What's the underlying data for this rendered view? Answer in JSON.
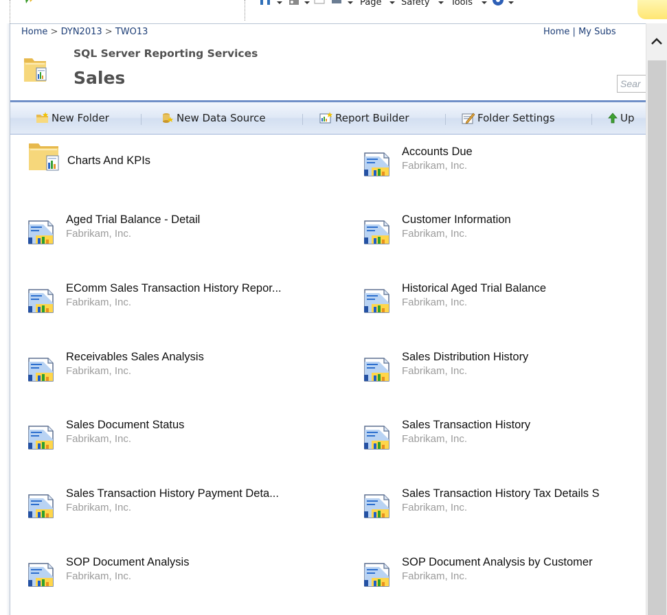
{
  "browser_commandbar": {
    "page_label": "Page",
    "safety_label": "Safety",
    "tools_label": "Tools"
  },
  "breadcrumb": {
    "home": "Home",
    "sep": ">",
    "server": "DYN2013",
    "company": "TWO13"
  },
  "top_links": {
    "home": "Home",
    "divider": "|",
    "my_subscriptions": "My Subs"
  },
  "header": {
    "product_name": "SQL Server Reporting Services",
    "title": "Sales",
    "search_placeholder": "Sear"
  },
  "toolbar": {
    "new_folder": "New Folder",
    "new_data_source": "New Data Source",
    "report_builder": "Report Builder",
    "folder_settings": "Folder Settings",
    "up": "Up"
  },
  "items": {
    "left": [
      {
        "name": "Charts And KPIs",
        "desc": ""
      },
      {
        "name": "Aged Trial Balance - Detail",
        "desc": "Fabrikam, Inc."
      },
      {
        "name": "EComm Sales Transaction History Repor...",
        "desc": "Fabrikam, Inc."
      },
      {
        "name": "Receivables Sales Analysis",
        "desc": "Fabrikam, Inc."
      },
      {
        "name": "Sales Document Status",
        "desc": "Fabrikam, Inc."
      },
      {
        "name": "Sales Transaction History Payment Deta...",
        "desc": "Fabrikam, Inc."
      },
      {
        "name": "SOP Document Analysis",
        "desc": "Fabrikam, Inc."
      }
    ],
    "right": [
      {
        "name": "Accounts Due",
        "desc": "Fabrikam, Inc."
      },
      {
        "name": "Customer Information",
        "desc": "Fabrikam, Inc."
      },
      {
        "name": "Historical Aged Trial Balance",
        "desc": "Fabrikam, Inc."
      },
      {
        "name": "Sales Distribution History",
        "desc": "Fabrikam, Inc."
      },
      {
        "name": "Sales Transaction History",
        "desc": "Fabrikam, Inc."
      },
      {
        "name": "Sales Transaction History Tax Details S",
        "desc": "Fabrikam, Inc."
      },
      {
        "name": "SOP Document Analysis by Customer",
        "desc": "Fabrikam, Inc."
      }
    ]
  },
  "icons": {
    "folder": "folder-report-icon",
    "report": "report-icon"
  }
}
